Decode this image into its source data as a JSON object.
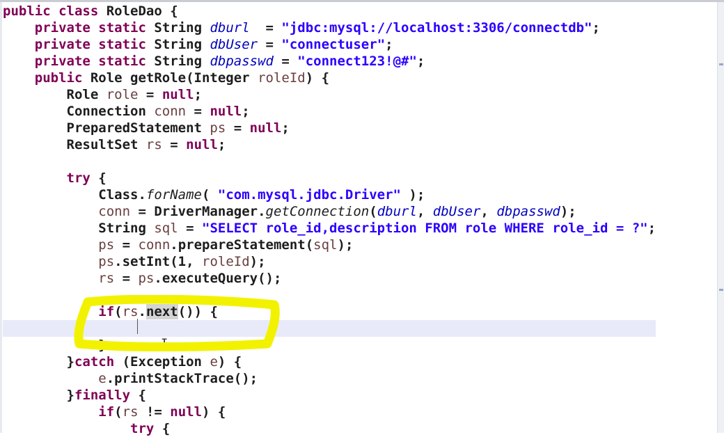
{
  "editor": {
    "language": "java",
    "current_line_index": 19,
    "highlighted_word": "next",
    "annotation": {
      "color": "#f2f200",
      "shape": "hand-drawn-rectangle"
    },
    "lines": [
      [
        {
          "t": "kw",
          "v": "public"
        },
        {
          "v": " "
        },
        {
          "t": "kw",
          "v": "class"
        },
        {
          "v": " RoleDao {"
        }
      ],
      [
        {
          "v": "    "
        },
        {
          "t": "kw",
          "v": "private"
        },
        {
          "v": " "
        },
        {
          "t": "kw",
          "v": "static"
        },
        {
          "v": " String "
        },
        {
          "t": "fld",
          "v": "dburl"
        },
        {
          "v": "  = "
        },
        {
          "t": "str",
          "v": "\"jdbc:mysql://localhost:3306/connectdb\""
        },
        {
          "v": ";"
        }
      ],
      [
        {
          "v": "    "
        },
        {
          "t": "kw",
          "v": "private"
        },
        {
          "v": " "
        },
        {
          "t": "kw",
          "v": "static"
        },
        {
          "v": " String "
        },
        {
          "t": "fld",
          "v": "dbUser"
        },
        {
          "v": " = "
        },
        {
          "t": "str",
          "v": "\"connectuser\""
        },
        {
          "v": ";"
        }
      ],
      [
        {
          "v": "    "
        },
        {
          "t": "kw",
          "v": "private"
        },
        {
          "v": " "
        },
        {
          "t": "kw",
          "v": "static"
        },
        {
          "v": " String "
        },
        {
          "t": "fld",
          "v": "dbpasswd"
        },
        {
          "v": " = "
        },
        {
          "t": "str",
          "v": "\"connect123!@#\""
        },
        {
          "v": ";"
        }
      ],
      [
        {
          "v": "    "
        },
        {
          "t": "kw",
          "v": "public"
        },
        {
          "v": " Role getRole(Integer "
        },
        {
          "t": "var",
          "v": "roleId"
        },
        {
          "v": ") {"
        }
      ],
      [
        {
          "v": "        Role "
        },
        {
          "t": "var",
          "v": "role"
        },
        {
          "v": " = "
        },
        {
          "t": "kw",
          "v": "null"
        },
        {
          "v": ";"
        }
      ],
      [
        {
          "v": "        Connection "
        },
        {
          "t": "var",
          "v": "conn"
        },
        {
          "v": " = "
        },
        {
          "t": "kw",
          "v": "null"
        },
        {
          "v": ";"
        }
      ],
      [
        {
          "v": "        PreparedStatement "
        },
        {
          "t": "var",
          "v": "ps"
        },
        {
          "v": " = "
        },
        {
          "t": "kw",
          "v": "null"
        },
        {
          "v": ";"
        }
      ],
      [
        {
          "v": "        ResultSet "
        },
        {
          "t": "var",
          "v": "rs"
        },
        {
          "v": " = "
        },
        {
          "t": "kw",
          "v": "null"
        },
        {
          "v": ";"
        }
      ],
      [],
      [
        {
          "v": "        "
        },
        {
          "t": "kw",
          "v": "try"
        },
        {
          "v": " {"
        }
      ],
      [
        {
          "v": "            Class."
        },
        {
          "t": "sm",
          "v": "forName"
        },
        {
          "v": "( "
        },
        {
          "t": "str",
          "v": "\"com.mysql.jdbc.Driver\""
        },
        {
          "v": " );"
        }
      ],
      [
        {
          "v": "            "
        },
        {
          "t": "var",
          "v": "conn"
        },
        {
          "v": " = DriverManager."
        },
        {
          "t": "sm",
          "v": "getConnection"
        },
        {
          "v": "("
        },
        {
          "t": "fld",
          "v": "dburl"
        },
        {
          "v": ", "
        },
        {
          "t": "fld",
          "v": "dbUser"
        },
        {
          "v": ", "
        },
        {
          "t": "fld",
          "v": "dbpasswd"
        },
        {
          "v": ");"
        }
      ],
      [
        {
          "v": "            String "
        },
        {
          "t": "var",
          "v": "sql"
        },
        {
          "v": " = "
        },
        {
          "t": "str",
          "v": "\"SELECT role_id,description FROM role WHERE role_id = ?\""
        },
        {
          "v": ";"
        }
      ],
      [
        {
          "v": "            "
        },
        {
          "t": "var",
          "v": "ps"
        },
        {
          "v": " = "
        },
        {
          "t": "var",
          "v": "conn"
        },
        {
          "v": ".prepareStatement("
        },
        {
          "t": "var",
          "v": "sql"
        },
        {
          "v": ");"
        }
      ],
      [
        {
          "v": "            "
        },
        {
          "t": "var",
          "v": "ps"
        },
        {
          "v": ".setInt(1, "
        },
        {
          "t": "var",
          "v": "roleId"
        },
        {
          "v": ");"
        }
      ],
      [
        {
          "v": "            "
        },
        {
          "t": "var",
          "v": "rs"
        },
        {
          "v": " = "
        },
        {
          "t": "var",
          "v": "ps"
        },
        {
          "v": ".executeQuery();"
        }
      ],
      [],
      [
        {
          "v": "            "
        },
        {
          "t": "kw",
          "v": "if"
        },
        {
          "v": "("
        },
        {
          "t": "var",
          "v": "rs"
        },
        {
          "v": "."
        },
        {
          "t": "hl",
          "v": "next"
        },
        {
          "v": "()) {"
        }
      ],
      [],
      [
        {
          "v": "            }"
        }
      ],
      [
        {
          "v": "        }"
        },
        {
          "t": "kw",
          "v": "catch"
        },
        {
          "v": " (Exception "
        },
        {
          "t": "var",
          "v": "e"
        },
        {
          "v": ") {"
        }
      ],
      [
        {
          "v": "            "
        },
        {
          "t": "var",
          "v": "e"
        },
        {
          "v": ".printStackTrace();"
        }
      ],
      [
        {
          "v": "        }"
        },
        {
          "t": "kw",
          "v": "finally"
        },
        {
          "v": " {"
        }
      ],
      [
        {
          "v": "            "
        },
        {
          "t": "kw",
          "v": "if"
        },
        {
          "v": "("
        },
        {
          "t": "var",
          "v": "rs"
        },
        {
          "v": " != "
        },
        {
          "t": "kw",
          "v": "null"
        },
        {
          "v": ") {"
        }
      ],
      [
        {
          "v": "                "
        },
        {
          "t": "kw",
          "v": "try"
        },
        {
          "v": " {"
        }
      ]
    ]
  }
}
